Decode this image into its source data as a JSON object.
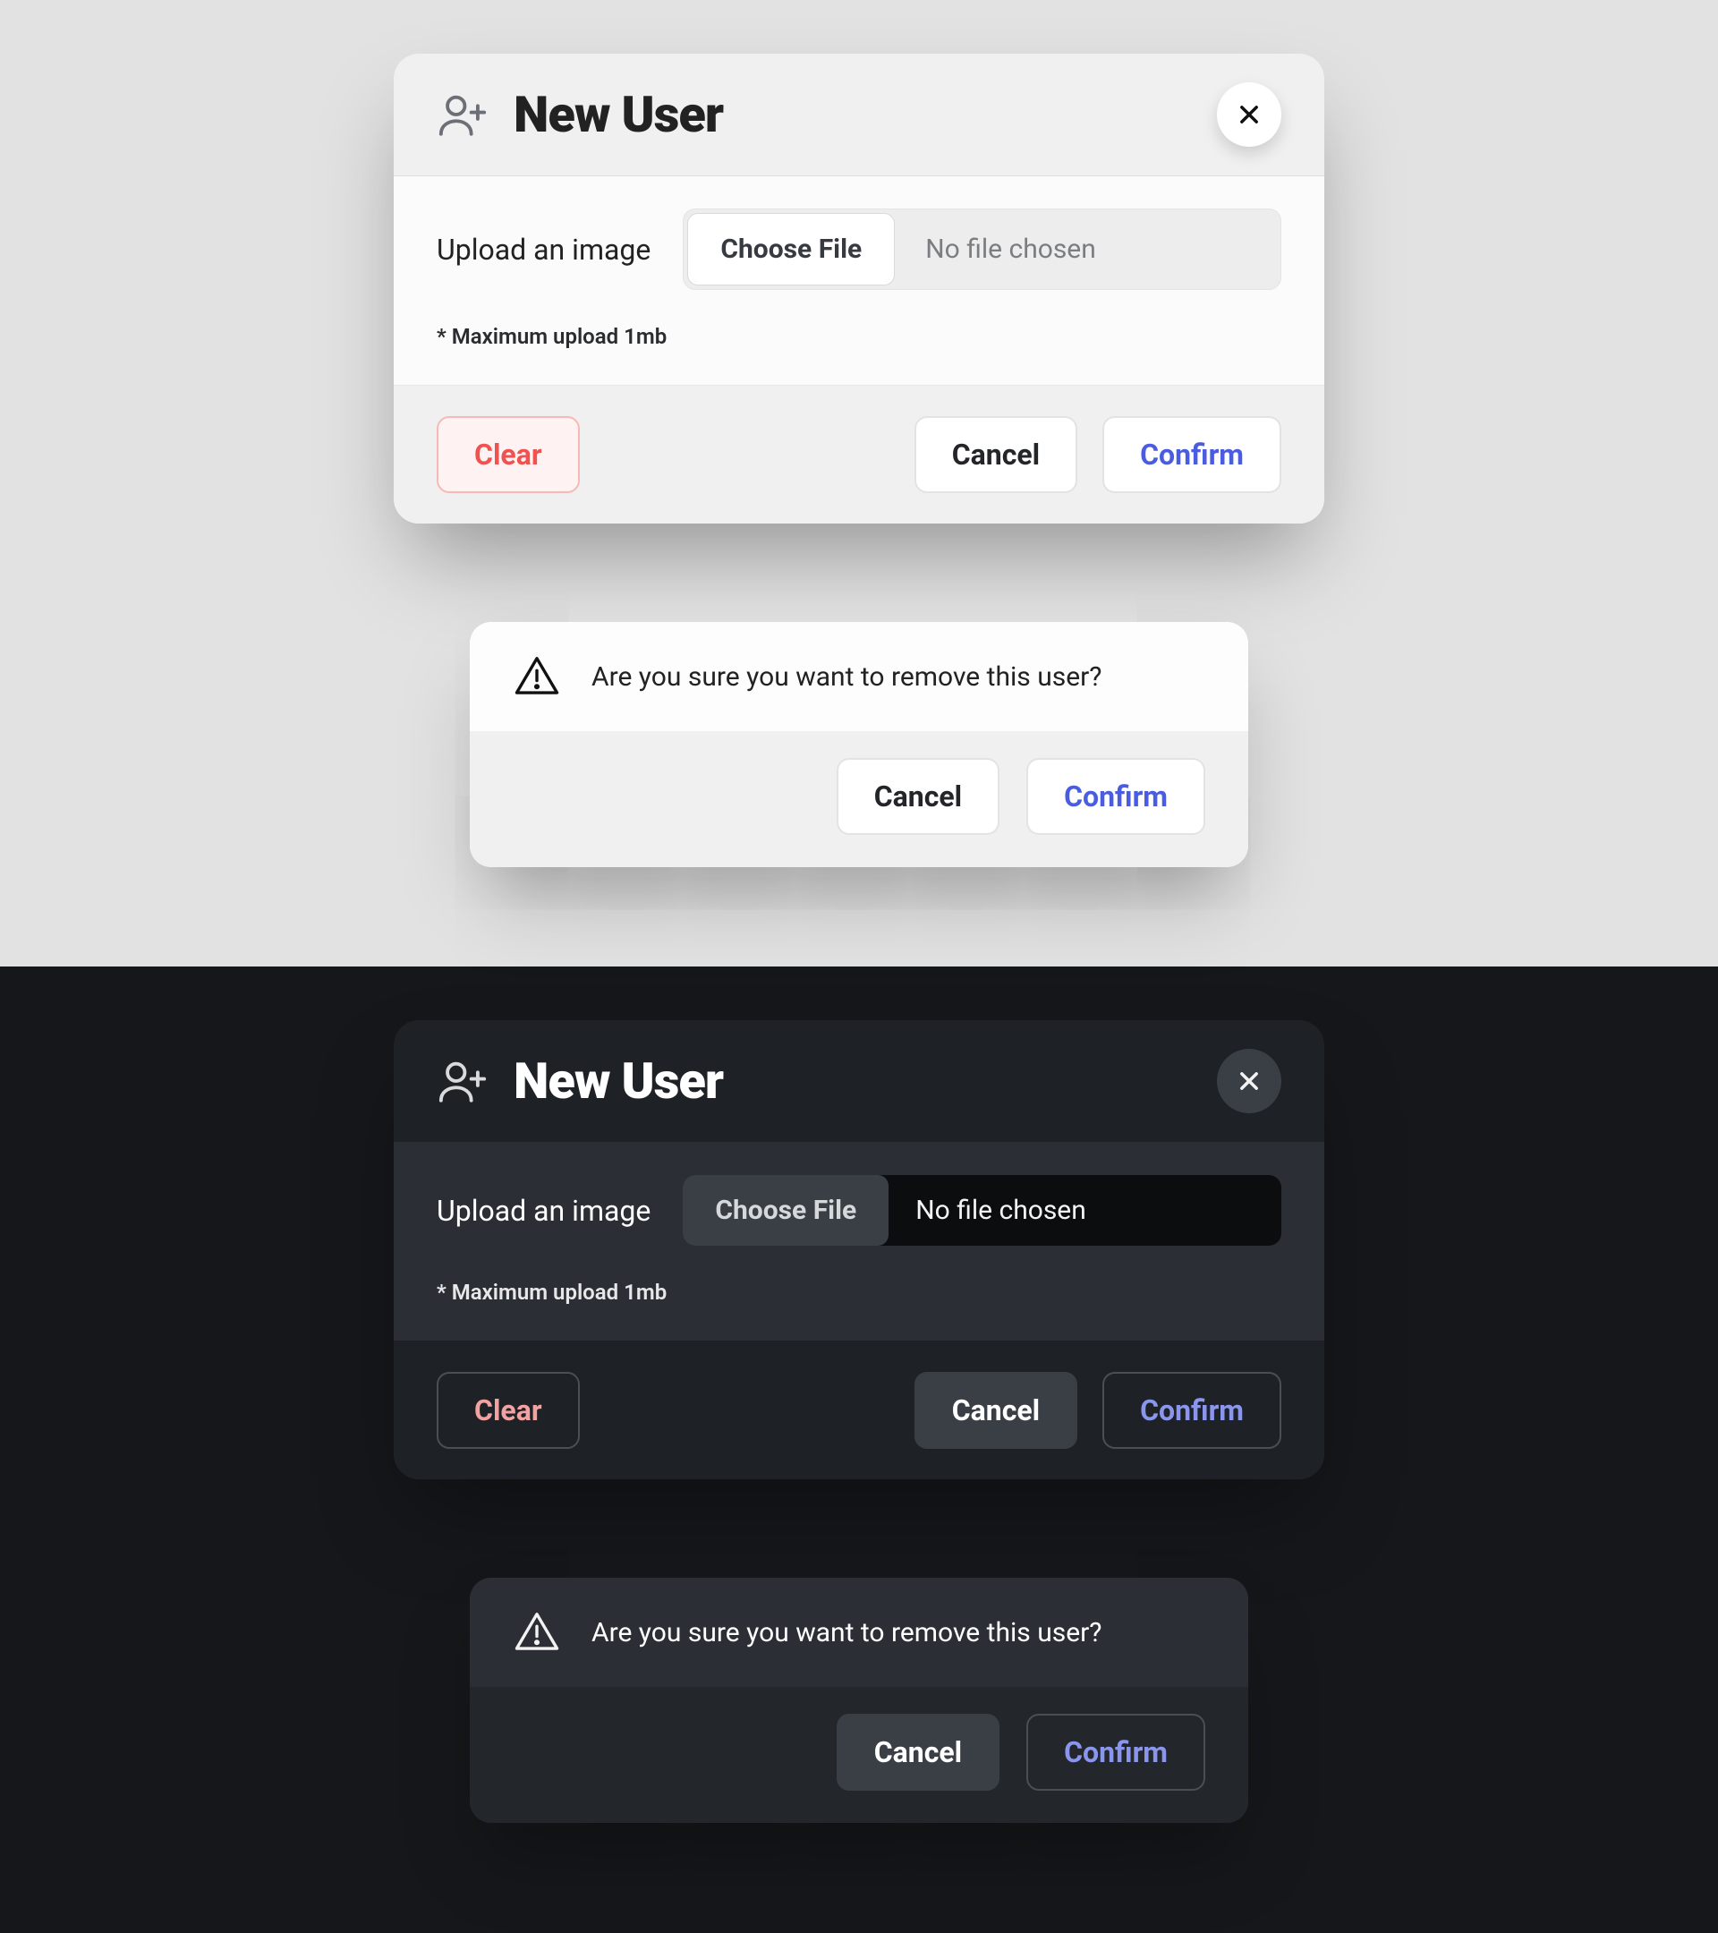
{
  "new_user_modal": {
    "title": "New User",
    "upload_label": "Upload an image",
    "choose_file_label": "Choose File",
    "file_name_placeholder": "No file chosen",
    "hint": "* Maximum upload 1mb",
    "buttons": {
      "clear": "Clear",
      "cancel": "Cancel",
      "confirm": "Confirm"
    }
  },
  "confirm_modal": {
    "message": "Are you sure you want to remove this user?",
    "buttons": {
      "cancel": "Cancel",
      "confirm": "Confirm"
    }
  },
  "colors": {
    "light_bg": "#E2E2E2",
    "dark_bg": "#15171A",
    "danger": "#F0524F",
    "primary": "#4A5DE0"
  }
}
